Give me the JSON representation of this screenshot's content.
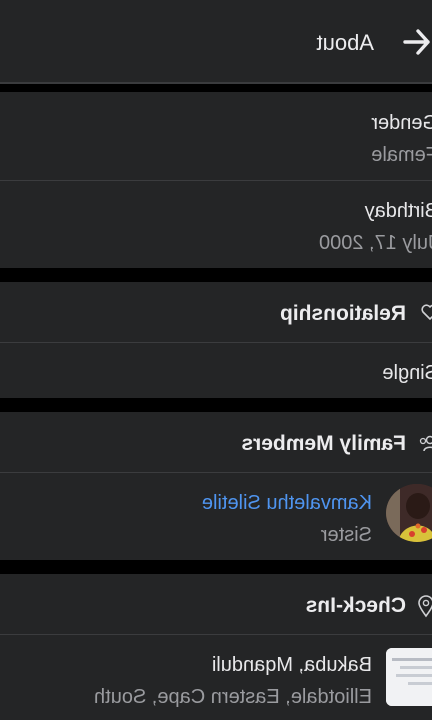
{
  "header": {
    "title": "About",
    "back_icon": "arrow-left-icon"
  },
  "basic_info": {
    "gender": {
      "label": "Gender",
      "value": "Female"
    },
    "birthday": {
      "label": "Birthday",
      "value": "July 17, 2000"
    }
  },
  "relationship": {
    "title": "Relationship",
    "icon": "heart-icon",
    "status": "Single"
  },
  "family": {
    "title": "Family Members",
    "icon": "people-icon",
    "members": [
      {
        "name": "Kamvalethu Siletile",
        "relation": "Sister"
      }
    ]
  },
  "checkins": {
    "title": "Check-Ins",
    "icon": "location-pin-icon",
    "items": [
      {
        "place": "Bakuba, Mqanduli",
        "address": "Elliotdale, Eastern Cape, South"
      }
    ]
  },
  "colors": {
    "background": "#000000",
    "card": "#242526",
    "link": "#4f95f0",
    "secondary_text": "#9a9b9f"
  }
}
